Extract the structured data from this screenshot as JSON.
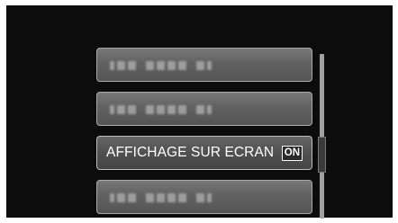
{
  "menu": {
    "items": [
      {
        "label": "",
        "blurred": true
      },
      {
        "label": "",
        "blurred": true
      },
      {
        "label": "AFFICHAGE SUR ECRAN",
        "value": "ON",
        "selected": true
      },
      {
        "label": "",
        "blurred": true
      }
    ]
  },
  "colors": {
    "background": "#0c0c0c",
    "item_fill": "#616161",
    "item_border": "#a9a9a9",
    "text": "#ffffff"
  }
}
